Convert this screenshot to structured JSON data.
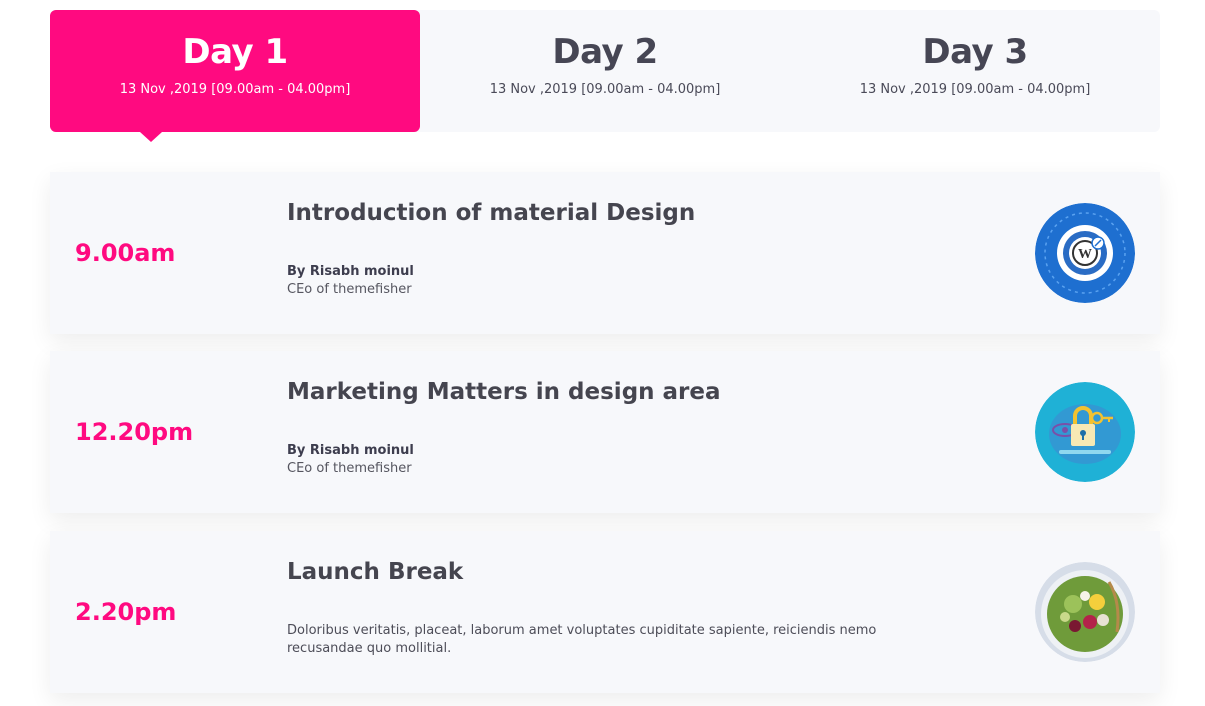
{
  "tabs": [
    {
      "title": "Day 1",
      "date": "13 Nov ,2019 [09.00am - 04.00pm]",
      "active": true
    },
    {
      "title": "Day 2",
      "date": "13 Nov ,2019 [09.00am - 04.00pm]",
      "active": false
    },
    {
      "title": "Day 3",
      "date": "13 Nov ,2019 [09.00am - 04.00pm]",
      "active": false
    }
  ],
  "sessions": [
    {
      "time": "9.00am",
      "title": "Introduction of material Design",
      "speaker": "By Risabh moinul",
      "role": "CEo of themefisher",
      "icon": "wordpress-icon"
    },
    {
      "time": "12.20pm",
      "title": "Marketing Matters in design area",
      "speaker": "By Risabh moinul",
      "role": "CEo of themefisher",
      "icon": "security-lock-icon"
    },
    {
      "time": "2.20pm",
      "title": "Launch Break",
      "description": "Doloribus veritatis, placeat, laborum amet voluptates cupiditate sapiente, reiciendis nemo recusandae quo mollitial.",
      "icon": "salad-bowl-image"
    }
  ],
  "colors": {
    "accent": "#ff0a80",
    "card_bg": "#f7f8fb",
    "text_dark": "#45454f"
  }
}
